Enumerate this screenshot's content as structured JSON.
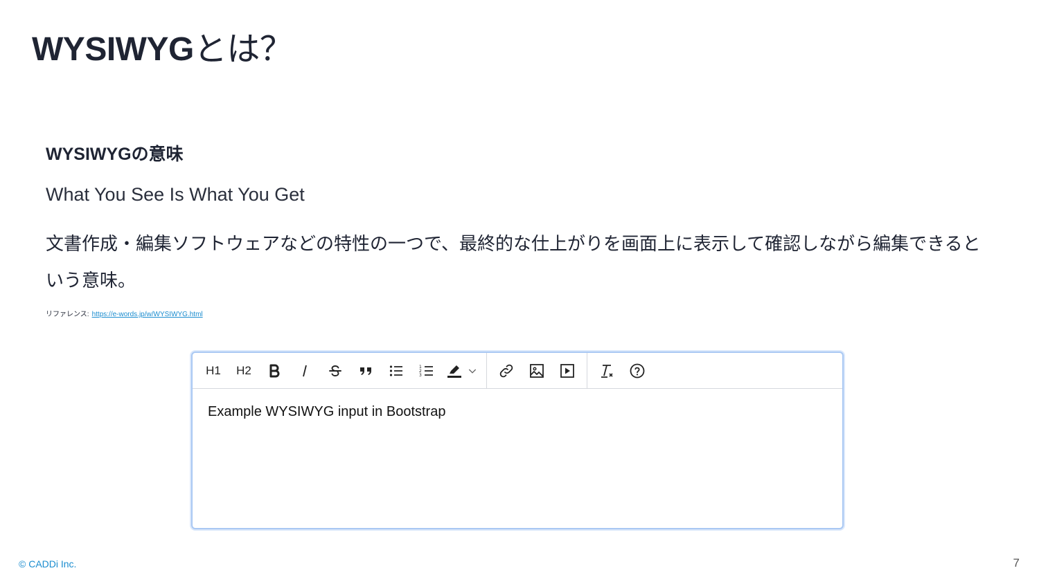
{
  "slide": {
    "title_main": "WYSIWYG",
    "title_jp": "とは？",
    "subheading": "WYSIWYGの意味",
    "phrase": "What You See Is What You Get",
    "description": "文書作成・編集ソフトウェアなどの特性の一つで、最終的な仕上がりを画面上に表示して確認しながら編集できるという意味。",
    "reference_label": "リファレンス:",
    "reference_url": "https://e-words.jp/w/WYSIWYG.html"
  },
  "editor": {
    "toolbar": {
      "h1": "H1",
      "h2": "H2",
      "icons": [
        "bold-icon",
        "italic-icon",
        "strikethrough-icon",
        "quote-icon",
        "bullet-list-icon",
        "numbered-list-icon",
        "highlight-icon",
        "chevron-down-icon",
        "link-icon",
        "image-icon",
        "video-icon",
        "clear-format-icon",
        "help-icon"
      ]
    },
    "content": "Example WYSIWYG input in Bootstrap"
  },
  "footer": {
    "copyright": "© CADDi Inc.",
    "page_number": "7"
  }
}
